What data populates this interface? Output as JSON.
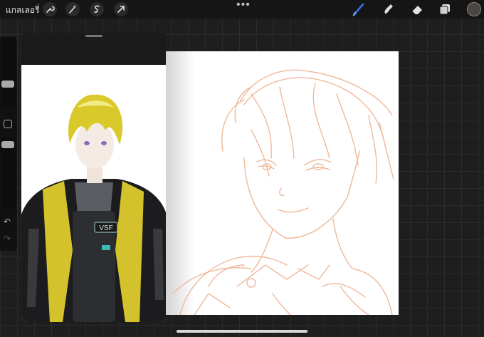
{
  "toolbar": {
    "gallery_label": "แกลเลอรี่",
    "actions_icon": "wrench-icon",
    "adjustments_icon": "magic-wand-icon",
    "selection_icon": "selection-s-icon",
    "transform_icon": "arrow-cursor-icon",
    "more_label": "•••",
    "brush_icon": "brush-icon",
    "smudge_icon": "smudge-icon",
    "eraser_icon": "eraser-icon",
    "layers_icon": "layers-icon",
    "brush_color": "#3b6fe0",
    "current_color": "#4a4540"
  },
  "sidebar": {
    "undo_label": "↶",
    "redo_label": "↷"
  },
  "reference": {
    "content": "anime character illustration with yellow hair, dark jacket with yellow lining, vest labeled VSF"
  },
  "canvas": {
    "sketch_color": "#f0b89a",
    "content": "rough sketch of an anime boy's head and shoulders"
  }
}
